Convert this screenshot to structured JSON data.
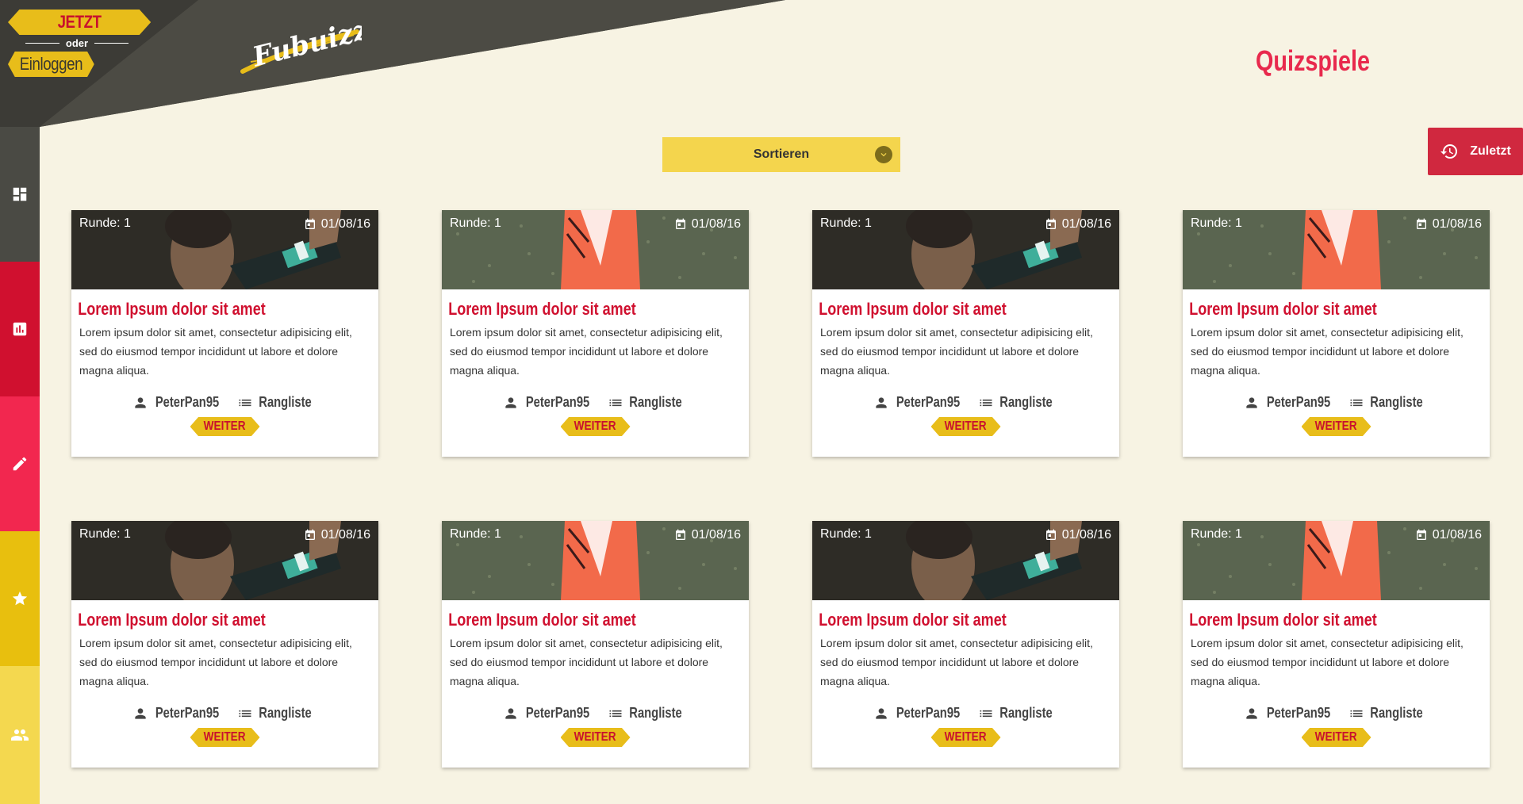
{
  "auth": {
    "register_label": "JETZT REGISTRIEREN",
    "or_label": "oder",
    "login_label": "Einloggen"
  },
  "logo": {
    "text": "Fubuizz"
  },
  "page": {
    "title": "Quizspiele"
  },
  "sort": {
    "label": "Sortieren"
  },
  "recent": {
    "label": "Zuletzt"
  },
  "sidebar": {
    "items": [
      {
        "icon": "dashboard-icon",
        "color": "#4a4a44"
      },
      {
        "icon": "chart-icon",
        "color": "#d0102f"
      },
      {
        "icon": "pencil-icon",
        "color": "#f2274f"
      },
      {
        "icon": "star-icon",
        "color": "#e8bf0e"
      },
      {
        "icon": "people-icon",
        "color": "#f4d84f"
      }
    ]
  },
  "cards": [
    {
      "image": "player",
      "round": "Runde: 1",
      "date": "01/08/16",
      "title": "Lorem Ipsum dolor sit amet",
      "text": "Lorem ipsum dolor sit amet, consectetur adipisicing elit, sed do eiusmod tempor incididunt ut labore et dolore magna aliqua.",
      "user": "PeterPan95",
      "ranking": "Rangliste",
      "action": "WEITER"
    },
    {
      "image": "shoe",
      "round": "Runde: 1",
      "date": "01/08/16",
      "title": "Lorem Ipsum dolor sit amet",
      "text": "Lorem ipsum dolor sit amet, consectetur adipisicing elit, sed do eiusmod tempor incididunt ut labore et dolore magna aliqua.",
      "user": "PeterPan95",
      "ranking": "Rangliste",
      "action": "WEITER"
    },
    {
      "image": "player",
      "round": "Runde: 1",
      "date": "01/08/16",
      "title": "Lorem Ipsum dolor sit amet",
      "text": "Lorem ipsum dolor sit amet, consectetur adipisicing elit, sed do eiusmod tempor incididunt ut labore et dolore magna aliqua.",
      "user": "PeterPan95",
      "ranking": "Rangliste",
      "action": "WEITER"
    },
    {
      "image": "shoe",
      "round": "Runde: 1",
      "date": "01/08/16",
      "title": "Lorem Ipsum dolor sit amet",
      "text": "Lorem ipsum dolor sit amet, consectetur adipisicing elit, sed do eiusmod tempor incididunt ut labore et dolore magna aliqua.",
      "user": "PeterPan95",
      "ranking": "Rangliste",
      "action": "WEITER"
    },
    {
      "image": "player",
      "round": "Runde: 1",
      "date": "01/08/16",
      "title": "Lorem Ipsum dolor sit amet",
      "text": "Lorem ipsum dolor sit amet, consectetur adipisicing elit, sed do eiusmod tempor incididunt ut labore et dolore magna aliqua.",
      "user": "PeterPan95",
      "ranking": "Rangliste",
      "action": "WEITER"
    },
    {
      "image": "shoe",
      "round": "Runde: 1",
      "date": "01/08/16",
      "title": "Lorem Ipsum dolor sit amet",
      "text": "Lorem ipsum dolor sit amet, consectetur adipisicing elit, sed do eiusmod tempor incididunt ut labore et dolore magna aliqua.",
      "user": "PeterPan95",
      "ranking": "Rangliste",
      "action": "WEITER"
    },
    {
      "image": "player",
      "round": "Runde: 1",
      "date": "01/08/16",
      "title": "Lorem Ipsum dolor sit amet",
      "text": "Lorem ipsum dolor sit amet, consectetur adipisicing elit, sed do eiusmod tempor incididunt ut labore et dolore magna aliqua.",
      "user": "PeterPan95",
      "ranking": "Rangliste",
      "action": "WEITER"
    },
    {
      "image": "shoe",
      "round": "Runde: 1",
      "date": "01/08/16",
      "title": "Lorem Ipsum dolor sit amet",
      "text": "Lorem ipsum dolor sit amet, consectetur adipisicing elit, sed do eiusmod tempor incididunt ut labore et dolore magna aliqua.",
      "user": "PeterPan95",
      "ranking": "Rangliste",
      "action": "WEITER"
    }
  ]
}
